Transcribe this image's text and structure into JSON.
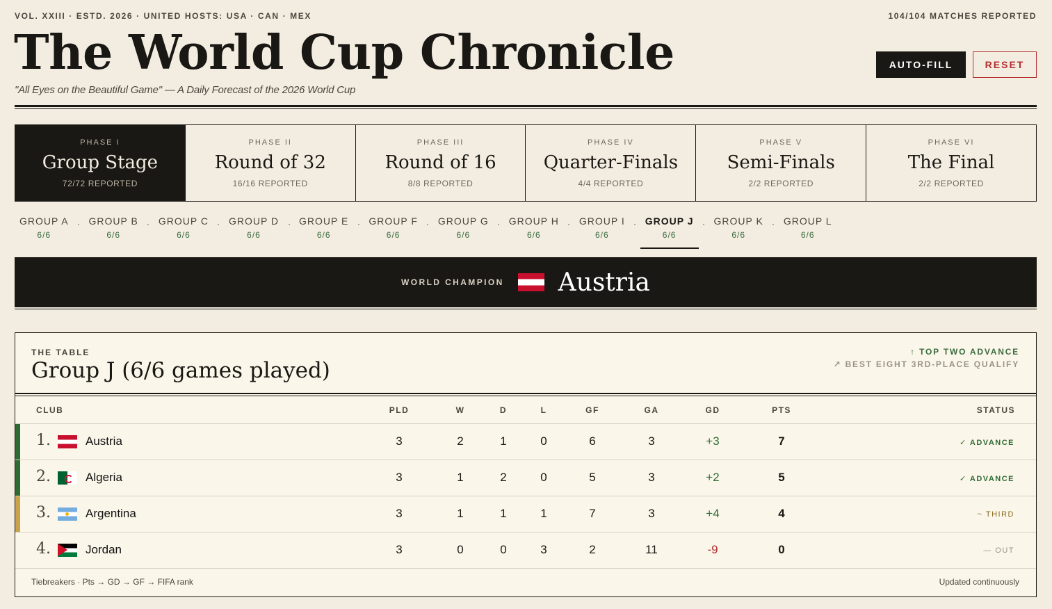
{
  "masthead": {
    "edition": "VOL. XXIII · ESTD. 2026 · UNITED HOSTS: USA · CAN · MEX",
    "matches_reported": "104/104 MATCHES REPORTED",
    "title": "The World Cup Chronicle",
    "tagline": "\"All Eyes on the Beautiful Game\" — A Daily Forecast of the 2026 World Cup",
    "autofill_label": "AUTO-FILL",
    "reset_label": "RESET"
  },
  "phases": [
    {
      "num": "PHASE I",
      "name": "Group Stage",
      "reported": "72/72 REPORTED",
      "active": true
    },
    {
      "num": "PHASE II",
      "name": "Round of 32",
      "reported": "16/16 REPORTED"
    },
    {
      "num": "PHASE III",
      "name": "Round of 16",
      "reported": "8/8 REPORTED"
    },
    {
      "num": "PHASE IV",
      "name": "Quarter-Finals",
      "reported": "4/4 REPORTED"
    },
    {
      "num": "PHASE V",
      "name": "Semi-Finals",
      "reported": "2/2 REPORTED"
    },
    {
      "num": "PHASE VI",
      "name": "The Final",
      "reported": "2/2 REPORTED"
    }
  ],
  "groups": [
    {
      "label": "GROUP A",
      "count": "6/6"
    },
    {
      "label": "GROUP B",
      "count": "6/6"
    },
    {
      "label": "GROUP C",
      "count": "6/6"
    },
    {
      "label": "GROUP D",
      "count": "6/6"
    },
    {
      "label": "GROUP E",
      "count": "6/6"
    },
    {
      "label": "GROUP F",
      "count": "6/6"
    },
    {
      "label": "GROUP G",
      "count": "6/6"
    },
    {
      "label": "GROUP H",
      "count": "6/6"
    },
    {
      "label": "GROUP I",
      "count": "6/6"
    },
    {
      "label": "GROUP J",
      "count": "6/6",
      "active": true
    },
    {
      "label": "GROUP K",
      "count": "6/6"
    },
    {
      "label": "GROUP L",
      "count": "6/6"
    }
  ],
  "champion": {
    "label": "WORLD CHAMPION",
    "team": "Austria",
    "flag": "austria-flag"
  },
  "table": {
    "kicker": "THE TABLE",
    "title": "Group J (6/6 games played)",
    "legend_advance": "↑ TOP TWO ADVANCE",
    "legend_third": "↗ BEST EIGHT 3RD-PLACE QUALIFY",
    "headers": {
      "club": "CLUB",
      "pld": "PLD",
      "w": "W",
      "d": "D",
      "l": "L",
      "gf": "GF",
      "ga": "GA",
      "gd": "GD",
      "pts": "PTS",
      "status": "STATUS"
    },
    "rows": [
      {
        "pos": "1.",
        "team": "Austria",
        "flag": "austria-flag",
        "pld": "3",
        "w": "2",
        "d": "1",
        "l": "0",
        "gf": "6",
        "ga": "3",
        "gd": "+3",
        "pts": "7",
        "status": "✓ ADVANCE"
      },
      {
        "pos": "2.",
        "team": "Algeria",
        "flag": "algeria-flag",
        "pld": "3",
        "w": "1",
        "d": "2",
        "l": "0",
        "gf": "5",
        "ga": "3",
        "gd": "+2",
        "pts": "5",
        "status": "✓ ADVANCE"
      },
      {
        "pos": "3.",
        "team": "Argentina",
        "flag": "argentina-flag",
        "pld": "3",
        "w": "1",
        "d": "1",
        "l": "1",
        "gf": "7",
        "ga": "3",
        "gd": "+4",
        "pts": "4",
        "status": "~ THIRD"
      },
      {
        "pos": "4.",
        "team": "Jordan",
        "flag": "jordan-flag",
        "pld": "3",
        "w": "0",
        "d": "0",
        "l": "3",
        "gf": "2",
        "ga": "11",
        "gd": "-9",
        "pts": "0",
        "status": "— OUT"
      }
    ],
    "footer_left": "Tiebreakers · Pts → GD → GF → FIFA rank",
    "footer_right": "Updated continuously"
  },
  "colors": {
    "background": "#f3ede1",
    "ink": "#1a1814",
    "advance_green": "#2e6b34",
    "third_gold": "#c9a24a",
    "reset_red": "#b32d2e"
  }
}
